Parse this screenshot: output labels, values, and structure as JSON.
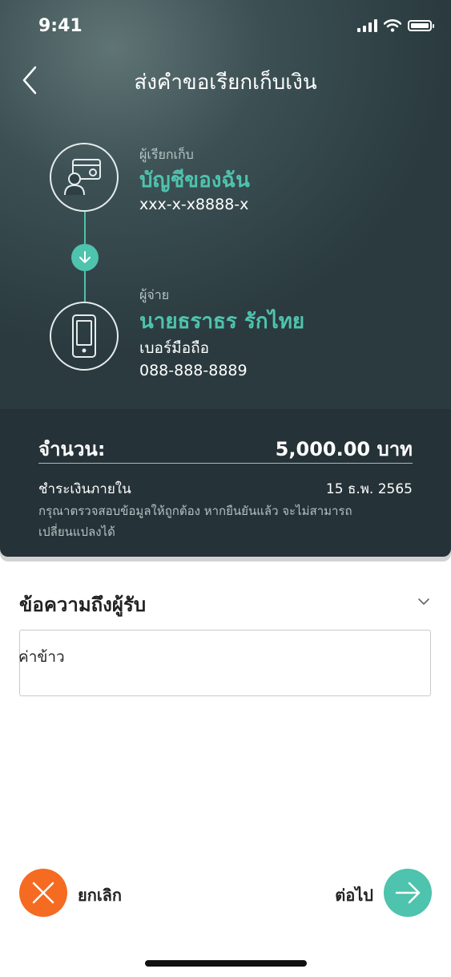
{
  "status_bar": {
    "time": "9:41"
  },
  "header": {
    "title": "ส่งคำขอเรียกเก็บเงิน"
  },
  "requester": {
    "label": "ผู้เรียกเก็บ",
    "name": "บัญชีของฉัน",
    "account": "xxx-x-x8888-x"
  },
  "payer": {
    "label": "ผู้จ่าย",
    "name": "นายธราธร รักไทย",
    "method": "เบอร์มือถือ",
    "phone": "088-888-8889"
  },
  "amount_panel": {
    "amount_label": "จำนวน:",
    "amount_value": "5,000.00 บาท",
    "due_label": "ชำระเงินภายใน",
    "due_date": "15 ธ.พ. 2565",
    "notice": "กรุณาตรวจสอบข้อมูลให้ถูกต้อง หากยืนยันแล้ว จะไม่สามารถเปลี่ยนแปลงได้"
  },
  "message": {
    "title": "ข้อความถึงผู้รับ",
    "value": "ค่าข้าว"
  },
  "actions": {
    "cancel_label": "ยกเลิก",
    "next_label": "ต่อไป"
  },
  "colors": {
    "accent_teal": "#4ec3ad",
    "cancel_orange": "#f56b21",
    "panel_dark": "#253237"
  }
}
